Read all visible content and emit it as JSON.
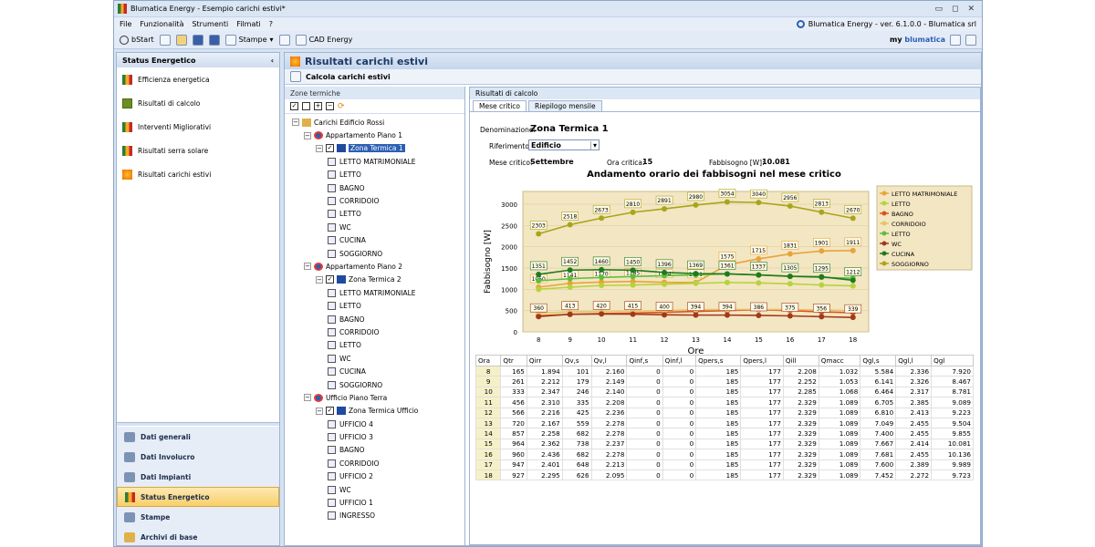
{
  "window": {
    "title": "Blumatica Energy - Esempio carichi estivi*",
    "version": "Blumatica Energy - ver. 6.1.0.0 - Blumatica srl"
  },
  "menu": [
    "File",
    "Funzionalità",
    "Strumenti",
    "Filmati",
    "?"
  ],
  "toolbar": {
    "start": "bStart",
    "stampe": "Stampe",
    "cad": "CAD Energy",
    "my": "my",
    "brand": "blumatica"
  },
  "sidebar": {
    "title": "Status Energetico",
    "items": [
      "Efficienza energetica",
      "Risultati di calcolo",
      "Interventi Migliorativi",
      "Risultati serra solare",
      "Risultati carichi estivi"
    ],
    "bottom": [
      "Dati generali",
      "Dati Involucro",
      "Dati Impianti",
      "Status Energetico",
      "Stampe",
      "Archivi di base"
    ]
  },
  "main": {
    "title": "Risultati carichi estivi",
    "subtitle": "Calcola carichi estivi"
  },
  "zones": {
    "header": "Zone termiche",
    "tree": [
      {
        "t": "Carichi Edificio Rossi",
        "lvl": 0,
        "kind": "root"
      },
      {
        "t": "Appartamento Piano 1",
        "lvl": 1,
        "kind": "apt"
      },
      {
        "t": "Zona Termica 1",
        "lvl": 2,
        "kind": "zone",
        "sel": true
      },
      {
        "t": "LETTO MATRIMONIALE",
        "lvl": 3,
        "kind": "room"
      },
      {
        "t": "LETTO",
        "lvl": 3,
        "kind": "room"
      },
      {
        "t": "BAGNO",
        "lvl": 3,
        "kind": "room"
      },
      {
        "t": "CORRIDOIO",
        "lvl": 3,
        "kind": "room"
      },
      {
        "t": "LETTO",
        "lvl": 3,
        "kind": "room"
      },
      {
        "t": "WC",
        "lvl": 3,
        "kind": "room"
      },
      {
        "t": "CUCINA",
        "lvl": 3,
        "kind": "room"
      },
      {
        "t": "SOGGIORNO",
        "lvl": 3,
        "kind": "room"
      },
      {
        "t": "Appartamento Piano 2",
        "lvl": 1,
        "kind": "apt"
      },
      {
        "t": "Zona Termica 2",
        "lvl": 2,
        "kind": "zone"
      },
      {
        "t": "LETTO MATRIMONIALE",
        "lvl": 3,
        "kind": "room"
      },
      {
        "t": "LETTO",
        "lvl": 3,
        "kind": "room"
      },
      {
        "t": "BAGNO",
        "lvl": 3,
        "kind": "room"
      },
      {
        "t": "CORRIDOIO",
        "lvl": 3,
        "kind": "room"
      },
      {
        "t": "LETTO",
        "lvl": 3,
        "kind": "room"
      },
      {
        "t": "WC",
        "lvl": 3,
        "kind": "room"
      },
      {
        "t": "CUCINA",
        "lvl": 3,
        "kind": "room"
      },
      {
        "t": "SOGGIORNO",
        "lvl": 3,
        "kind": "room"
      },
      {
        "t": "Ufficio Piano Terra",
        "lvl": 1,
        "kind": "apt"
      },
      {
        "t": "Zona Termica Ufficio",
        "lvl": 2,
        "kind": "zone"
      },
      {
        "t": "UFFICIO 4",
        "lvl": 3,
        "kind": "room"
      },
      {
        "t": "UFFICIO 3",
        "lvl": 3,
        "kind": "room"
      },
      {
        "t": "BAGNO",
        "lvl": 3,
        "kind": "room"
      },
      {
        "t": "CORRIDOIO",
        "lvl": 3,
        "kind": "room"
      },
      {
        "t": "UFFICIO 2",
        "lvl": 3,
        "kind": "room"
      },
      {
        "t": "WC",
        "lvl": 3,
        "kind": "room"
      },
      {
        "t": "UFFICIO 1",
        "lvl": 3,
        "kind": "room"
      },
      {
        "t": "INGRESSO",
        "lvl": 3,
        "kind": "room"
      }
    ]
  },
  "results": {
    "header": "Risultati di calcolo",
    "tabs": [
      "Mese critico",
      "Riepilogo mensile"
    ],
    "denominazione_label": "Denominazione:",
    "denominazione": "Zona Termica 1",
    "riferimento_label": "Riferimento:",
    "riferimento": "Edificio",
    "mese_label": "Mese critico:",
    "mese": "Settembre",
    "ora_label": "Ora critica:",
    "ora": "15",
    "fabb_label": "Fabbisogno [W]:",
    "fabb": "10.081"
  },
  "chart_data": {
    "type": "line",
    "title": "Andamento orario dei fabbisogni nel mese critico",
    "xlabel": "Ore",
    "ylabel": "Fabbisogno [W]",
    "ylim": [
      0,
      3300
    ],
    "yticks": [
      0,
      500,
      1000,
      1500,
      2000,
      2500,
      3000
    ],
    "x": [
      8,
      9,
      10,
      11,
      12,
      13,
      14,
      15,
      16,
      17,
      18
    ],
    "legend": "right",
    "series": [
      {
        "name": "LETTO MATRIMONIALE",
        "color": "#e8a33a",
        "values": [
          1050,
          1141,
          1170,
          1185,
          1164,
          1161,
          1575,
          1715,
          1831,
          1901,
          1911
        ],
        "labels": [
          1050,
          1141,
          1170,
          1185,
          1164,
          1161,
          1575,
          1715,
          1831,
          1901,
          1911
        ]
      },
      {
        "name": "LETTO",
        "color": "#b6d33b",
        "values": [
          1000,
          1050,
          1090,
          1100,
          1120,
          1140,
          1160,
          1150,
          1130,
          1100,
          1080
        ],
        "labels": []
      },
      {
        "name": "BAGNO",
        "color": "#d9531e",
        "values": [
          380,
          410,
          430,
          440,
          460,
          480,
          500,
          520,
          500,
          470,
          450
        ],
        "labels": []
      },
      {
        "name": "CORRIDOIO",
        "color": "#e6c36a",
        "values": [
          440,
          470,
          480,
          490,
          500,
          520,
          524,
          528,
          524,
          513,
          499
        ],
        "labels": []
      },
      {
        "name": "LETTO",
        "color": "#5fbf3b",
        "values": [
          1200,
          1250,
          1280,
          1300,
          1320,
          1340,
          1361,
          1337,
          1305,
          1280,
          1260
        ],
        "labels": []
      },
      {
        "name": "WC",
        "color": "#a0391e",
        "values": [
          360,
          413,
          420,
          415,
          400,
          394,
          394,
          386,
          375,
          356,
          339
        ],
        "labels": [
          360,
          413,
          420,
          415,
          400,
          394,
          394,
          386,
          375,
          356,
          339
        ]
      },
      {
        "name": "CUCINA",
        "color": "#1e7a1e",
        "values": [
          1351,
          1452,
          1460,
          1450,
          1396,
          1369,
          1361,
          1337,
          1305,
          1295,
          1212
        ],
        "labels": [
          1351,
          1452,
          1460,
          1450,
          1396,
          1369,
          1361,
          1337,
          1305,
          1295,
          1212
        ]
      },
      {
        "name": "SOGGIORNO",
        "color": "#a8a51a",
        "values": [
          2303,
          2518,
          2673,
          2810,
          2891,
          2980,
          3054,
          3040,
          2956,
          2813,
          2670
        ],
        "labels": [
          2303,
          2518,
          2673,
          2810,
          2891,
          2980,
          3054,
          3040,
          2956,
          2813,
          2670
        ]
      }
    ]
  },
  "table": {
    "headers": [
      "Ora",
      "Qtr",
      "Qirr",
      "Qv,s",
      "Qv,l",
      "Qinf,s",
      "Qinf,l",
      "Qpers,s",
      "Qpers,l",
      "Qill",
      "Qmacc",
      "Qgl,s",
      "Qgl,l",
      "Qgl"
    ],
    "rows": [
      [
        "8",
        "165",
        "1.894",
        "101",
        "2.160",
        "0",
        "0",
        "185",
        "177",
        "2.208",
        "1.032",
        "5.584",
        "2.336",
        "7.920"
      ],
      [
        "9",
        "261",
        "2.212",
        "179",
        "2.149",
        "0",
        "0",
        "185",
        "177",
        "2.252",
        "1.053",
        "6.141",
        "2.326",
        "8.467"
      ],
      [
        "10",
        "333",
        "2.347",
        "246",
        "2.140",
        "0",
        "0",
        "185",
        "177",
        "2.285",
        "1.068",
        "6.464",
        "2.317",
        "8.781"
      ],
      [
        "11",
        "456",
        "2.310",
        "335",
        "2.208",
        "0",
        "0",
        "185",
        "177",
        "2.329",
        "1.089",
        "6.705",
        "2.385",
        "9.089"
      ],
      [
        "12",
        "566",
        "2.216",
        "425",
        "2.236",
        "0",
        "0",
        "185",
        "177",
        "2.329",
        "1.089",
        "6.810",
        "2.413",
        "9.223"
      ],
      [
        "13",
        "720",
        "2.167",
        "559",
        "2.278",
        "0",
        "0",
        "185",
        "177",
        "2.329",
        "1.089",
        "7.049",
        "2.455",
        "9.504"
      ],
      [
        "14",
        "857",
        "2.258",
        "682",
        "2.278",
        "0",
        "0",
        "185",
        "177",
        "2.329",
        "1.089",
        "7.400",
        "2.455",
        "9.855"
      ],
      [
        "15",
        "964",
        "2.362",
        "738",
        "2.237",
        "0",
        "0",
        "185",
        "177",
        "2.329",
        "1.089",
        "7.667",
        "2.414",
        "10.081"
      ],
      [
        "16",
        "960",
        "2.436",
        "682",
        "2.278",
        "0",
        "0",
        "185",
        "177",
        "2.329",
        "1.089",
        "7.681",
        "2.455",
        "10.136"
      ],
      [
        "17",
        "947",
        "2.401",
        "648",
        "2.213",
        "0",
        "0",
        "185",
        "177",
        "2.329",
        "1.089",
        "7.600",
        "2.389",
        "9.989"
      ],
      [
        "18",
        "927",
        "2.295",
        "626",
        "2.095",
        "0",
        "0",
        "185",
        "177",
        "2.329",
        "1.089",
        "7.452",
        "2.272",
        "9.723"
      ]
    ]
  }
}
